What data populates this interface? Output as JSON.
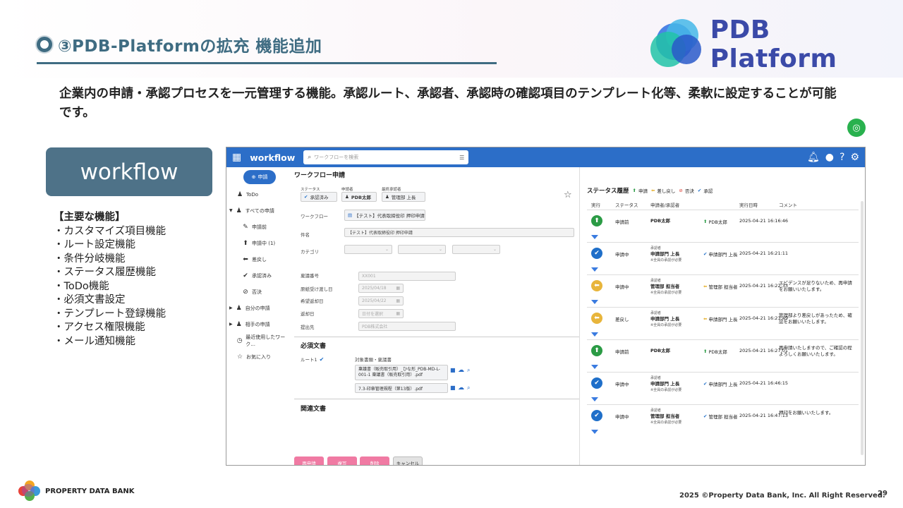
{
  "slide": {
    "title": "③PDB-Platformの拡充 機能追加",
    "logo_text": "PDB Platform",
    "lead": "企業内の申請・承認プロセスを一元管理する機能。承認ルート、承認者、承認時の確認項目のテンプレート化等、柔軟に設定することが可能です。",
    "section_box": "workflow",
    "features_heading": "【主要な機能】",
    "features": [
      "・カスタマイズ項目機能",
      "・ルート設定機能",
      "・条件分岐機能",
      "・ステータス履歴機能",
      "・ToDo機能",
      "・必須文書設定",
      "・テンプレート登録機能",
      "・アクセス権限機能",
      "・メール通知機能"
    ],
    "footer_company": "PROPERTY DATA BANK",
    "copyright": "2025 ©Property Data Bank, Inc. All Right Reserved.",
    "page_number": "29"
  },
  "app": {
    "name": "workflow",
    "search_placeholder": "ワークフローを検索",
    "sidebar": {
      "request_button": "申請",
      "items": [
        "ToDo",
        "すべての申請",
        "申請前",
        "申請中 (1)",
        "差戻し",
        "承認済み",
        "否決",
        "自分の申請",
        "相手の申請",
        "最近使用したワーク...",
        "お気に入り"
      ]
    },
    "form": {
      "page_title": "ワークフロー申請",
      "status_label": "ステータス",
      "status_value": "承認済み",
      "applicant_label": "申請者",
      "applicant_value": "PDB太郎",
      "final_approver_label": "最終承認者",
      "final_approver_value": "管理部 上長",
      "workflow_label": "ワークフロー",
      "workflow_value": "【テスト】代表取締役印 押印申請",
      "subject_label": "件名",
      "subject_value": "【テスト】代表取締役印 押印申請",
      "category_label": "カテゴリ",
      "approval_no_label": "稟議番号",
      "approval_no_value": "XX001",
      "original_date_label": "原紙受け渡し日",
      "original_date_value": "2025/04/18",
      "desired_return_label": "希望返却日",
      "desired_return_value": "2025/04/22",
      "return_date_label": "返却日",
      "return_date_value": "日付を選択",
      "submit_to_label": "提出先",
      "submit_to_value": "PDB株式会社",
      "required_docs_title": "必須文書",
      "route_label": "ルート1",
      "target_docs_label": "対象書類・稟議書",
      "doc1": "稟議書（販売取引用）_ひな形_PDB-MD-L-001-1 稟議書（販売取引用）.pdf",
      "doc2": "7.3-印章管理規程（第13版）.pdf",
      "related_docs_title": "関連文書",
      "btn_reapply": "再申請",
      "btn_copy": "複写",
      "btn_delete": "削除",
      "btn_cancel": "キャンセル"
    },
    "history": {
      "title": "ステータス履歴",
      "legend": [
        "申請",
        "差し戻し",
        "否決",
        "承認"
      ],
      "headers": [
        "実行",
        "ステータス",
        "申請者/承認者",
        "実行日時",
        "コメント"
      ],
      "rows": [
        {
          "status": "申請前",
          "role": "",
          "who": "PDB太郎",
          "note": "",
          "action": "PDB太郎",
          "date": "2025-04-21 16:16:46",
          "comment": "",
          "kind": "apply"
        },
        {
          "status": "申請中",
          "role": "承認者",
          "who": "申請部門 上長",
          "note": "※全員の承認が必要",
          "action": "申請部門 上長",
          "date": "2025-04-21 16:21:11",
          "comment": "",
          "kind": "approve"
        },
        {
          "status": "申請中",
          "role": "承認者",
          "who": "管理部 担当者",
          "note": "※全員の承認が必要",
          "action": "管理部 担当者",
          "date": "2025-04-21 16:22:33",
          "comment": "エビデンスが足りないため、再申請をお願いいたします。",
          "kind": "return"
        },
        {
          "status": "差戻し",
          "role": "承認者",
          "who": "申請部門 上長",
          "note": "※全員の承認が必要",
          "action": "申請部門 上長",
          "date": "2025-04-21 16:23:49",
          "comment": "管理部より差戻しがあったため、確認をお願いいたします。",
          "kind": "return"
        },
        {
          "status": "申請前",
          "role": "",
          "who": "PDB太郎",
          "note": "",
          "action": "PDB太郎",
          "date": "2025-04-21 16:27:01",
          "comment": "再申請いたしますので、ご確認の程よろしくお願いいたします。",
          "kind": "apply"
        },
        {
          "status": "申請中",
          "role": "承認者",
          "who": "申請部門 上長",
          "note": "※全員の承認が必要",
          "action": "申請部門 上長",
          "date": "2025-04-21 16:46:15",
          "comment": "",
          "kind": "approve"
        },
        {
          "status": "申請中",
          "role": "承認者",
          "who": "管理部 担当者",
          "note": "※全員の承認が必要",
          "action": "管理部 担当者",
          "date": "2025-04-21 16:47:13",
          "comment": "押印をお願いいたします。",
          "kind": "approve"
        }
      ]
    }
  },
  "colors": {
    "accent": "#3f6c82",
    "app_blue": "#2c6ec8",
    "pink": "#f07aa3",
    "apply_green": "#2b9b45",
    "return_yellow": "#e8b53b",
    "approve_blue": "#1f6fc9"
  }
}
